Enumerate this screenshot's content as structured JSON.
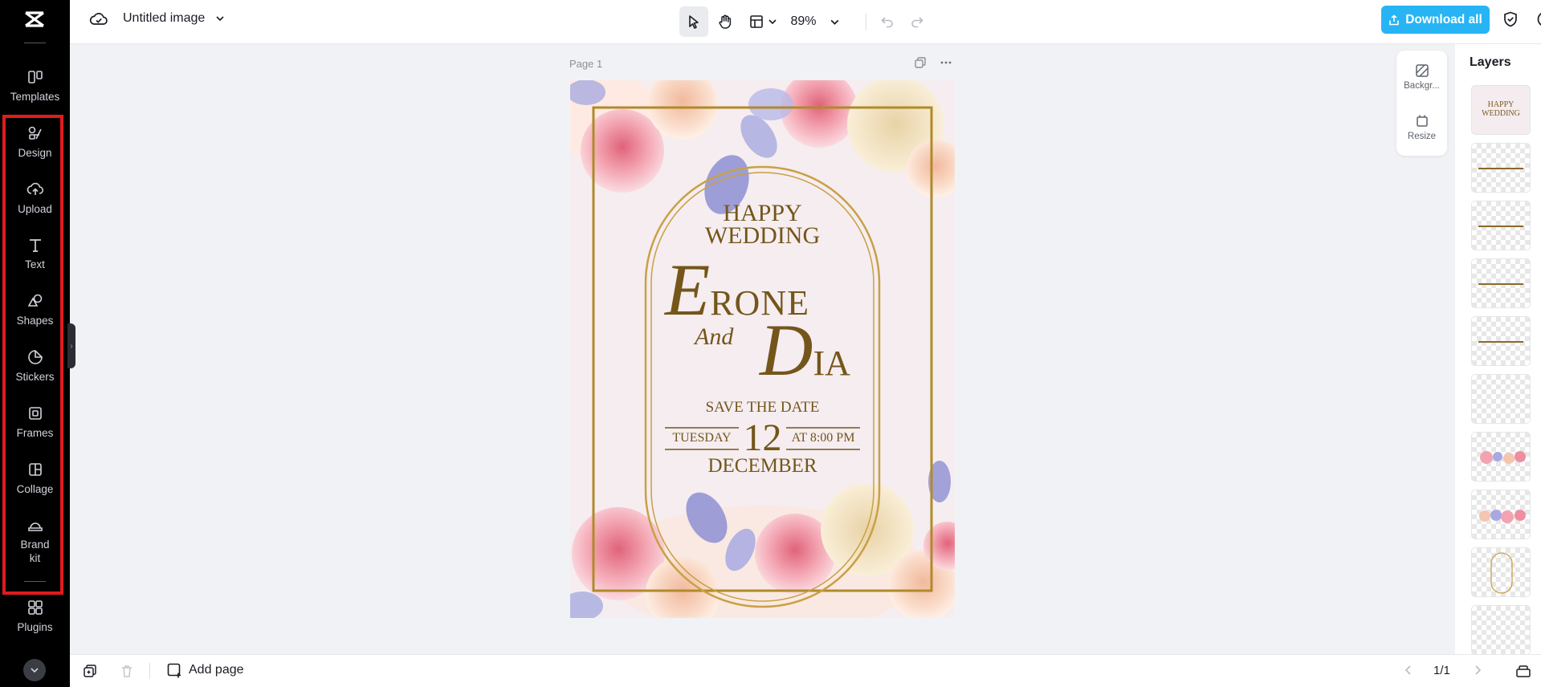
{
  "app": {
    "title": "Untitled image",
    "brand": "CapCut"
  },
  "sidebar": {
    "items": [
      {
        "label": "Templates",
        "icon": "templates-icon"
      },
      {
        "label": "Design",
        "icon": "design-icon"
      },
      {
        "label": "Upload",
        "icon": "upload-icon"
      },
      {
        "label": "Text",
        "icon": "text-icon"
      },
      {
        "label": "Shapes",
        "icon": "shapes-icon"
      },
      {
        "label": "Stickers",
        "icon": "stickers-icon"
      },
      {
        "label": "Frames",
        "icon": "frames-icon"
      },
      {
        "label": "Collage",
        "icon": "collage-icon"
      },
      {
        "label": "Brand kit",
        "icon": "brand-kit-icon"
      },
      {
        "label": "Plugins",
        "icon": "plugins-icon"
      }
    ],
    "highlight_color": "#e11b1b"
  },
  "toolbar": {
    "zoom": "89%",
    "download_label": "Download all",
    "accent": "#27b4f5"
  },
  "canvas": {
    "page_label": "Page 1",
    "invitation": {
      "line1": "HAPPY",
      "line2": "WEDDING",
      "name1_initial": "E",
      "name1_rest": "RONE",
      "and_text": "And",
      "name2_initial": "D",
      "name2_rest": "IA",
      "save_the_date": "SAVE THE DATE",
      "day": "TUESDAY",
      "date": "12",
      "time": "AT 8:00 PM",
      "month": "DECEMBER"
    }
  },
  "float_panel": {
    "background_label": "Backgr...",
    "resize_label": "Resize"
  },
  "layers": {
    "title": "Layers",
    "first_thumb_text_1": "HAPPY",
    "first_thumb_text_2": "WEDDING"
  },
  "bottom": {
    "add_page_label": "Add page",
    "pager": "1/1"
  }
}
